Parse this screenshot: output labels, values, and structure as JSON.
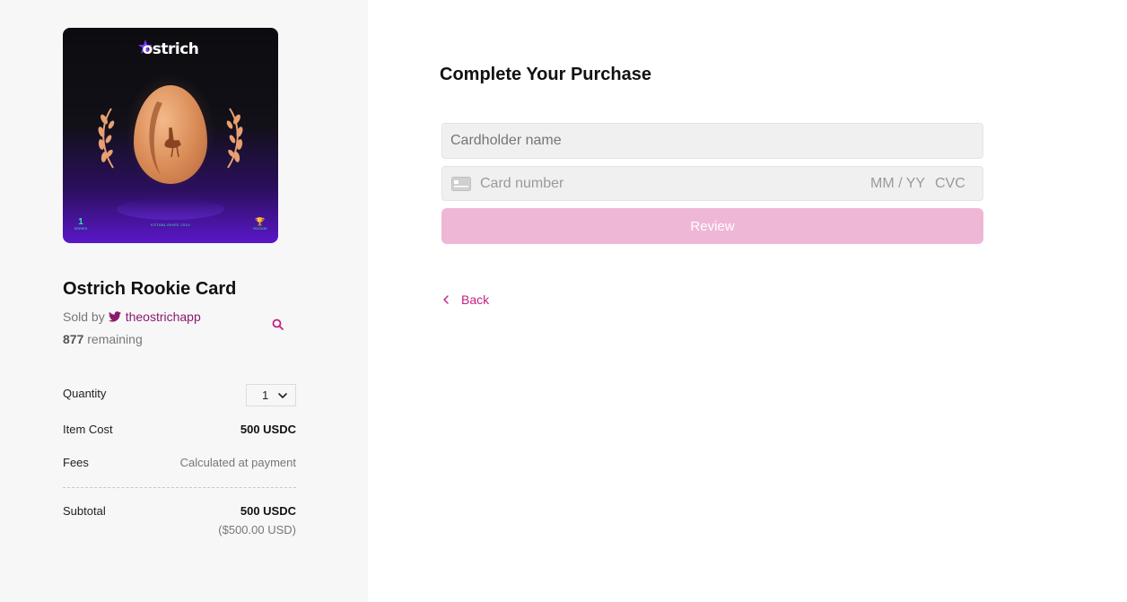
{
  "product": {
    "art": {
      "logo_text": "ostrich",
      "series_number": "1",
      "series_label": "SERIES",
      "established": "ESTABLISHED 2019",
      "rookie_label": "ROOKIE"
    },
    "title": "Ostrich Rookie Card",
    "sold_by_label": "Sold by",
    "seller": "theostrichapp",
    "remaining_count": "877",
    "remaining_label": "remaining"
  },
  "summary": {
    "quantity_label": "Quantity",
    "quantity_value": "1",
    "item_cost_label": "Item Cost",
    "item_cost_value": "500 USDC",
    "fees_label": "Fees",
    "fees_value": "Calculated at payment",
    "subtotal_label": "Subtotal",
    "subtotal_value": "500 USDC",
    "subtotal_usd": "($500.00 USD)"
  },
  "checkout": {
    "heading": "Complete Your Purchase",
    "cardholder_placeholder": "Cardholder name",
    "card_number_placeholder": "Card number",
    "expiry_placeholder": "MM / YY",
    "cvc_placeholder": "CVC",
    "review_label": "Review",
    "back_label": "Back"
  },
  "colors": {
    "accent": "#c41f84",
    "seller": "#8a1a6c",
    "review_button": "#efb7d6",
    "left_panel": "#f7f7f7"
  },
  "icons": [
    "twitter-icon",
    "search-icon",
    "chevron-down-icon",
    "credit-card-icon",
    "chevron-left-icon"
  ]
}
